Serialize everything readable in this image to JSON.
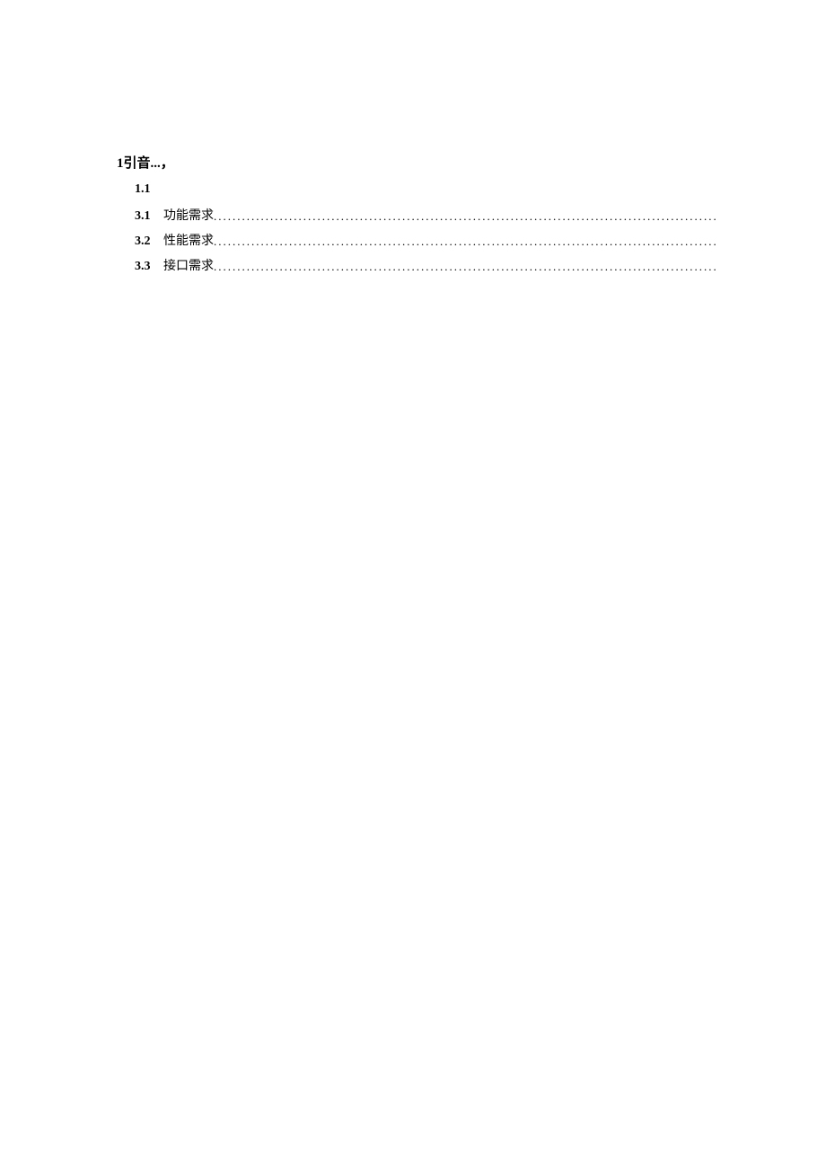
{
  "heading1": {
    "num": "1",
    "text": "引音...，"
  },
  "heading2": {
    "num": "1.1",
    "text": ""
  },
  "toc": [
    {
      "num": "3.1",
      "label": "功能需求"
    },
    {
      "num": "3.2",
      "label": "性能需求"
    },
    {
      "num": "3.3",
      "label": "接口需求"
    }
  ]
}
